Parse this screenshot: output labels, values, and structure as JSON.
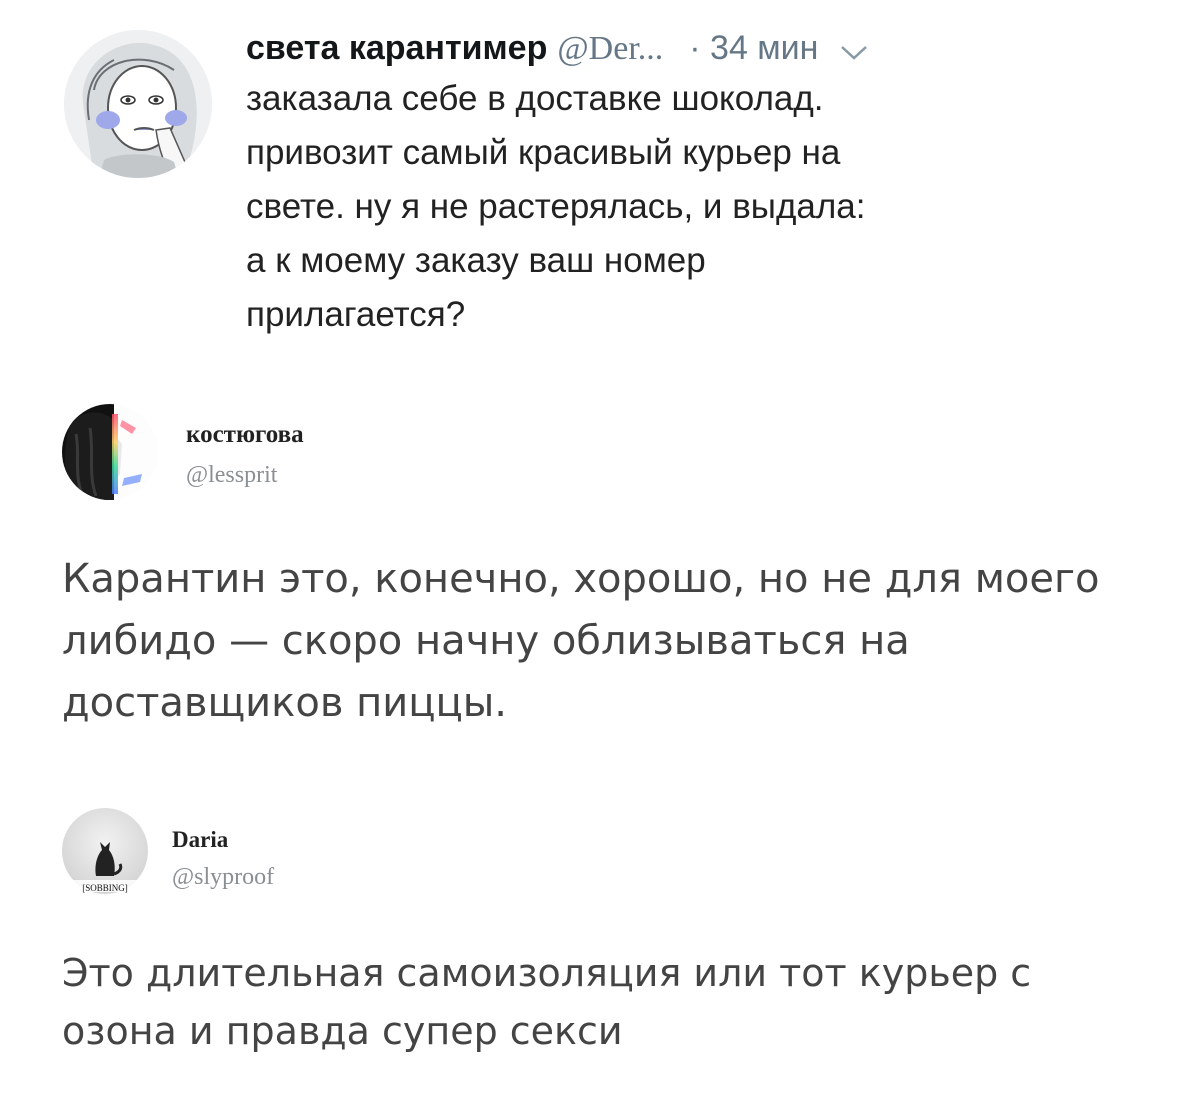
{
  "tweet": {
    "author_name": "света карантимер",
    "author_handle": "@Der...",
    "time": "· 34 мин",
    "lines": [
      "заказала себе в доставке шоколад.",
      "привозит самый красивый курьер на",
      "свете. ну я не растерялась, и выдала:",
      "а к моему заказу ваш номер",
      "прилагается?"
    ]
  },
  "reply1": {
    "author_name": "костюгова",
    "author_handle": "@lessprit",
    "lines": [
      "Карантин это, конечно, хорошо, но не для моего",
      "либидо — скоро начну облизываться на",
      "доставщиков пиццы."
    ]
  },
  "reply2": {
    "author_name": "Daria",
    "author_handle": "@slyproof",
    "avatar_caption": "[SOBBING]",
    "lines": [
      "Это длительная самоизоляция или тот курьер с",
      "озона и правда супер секси"
    ]
  },
  "colors": {
    "text": "#14171a",
    "secondary": "#657786",
    "reply_text": "#444444"
  },
  "icons": {
    "chevron": "chevron-down-icon"
  }
}
